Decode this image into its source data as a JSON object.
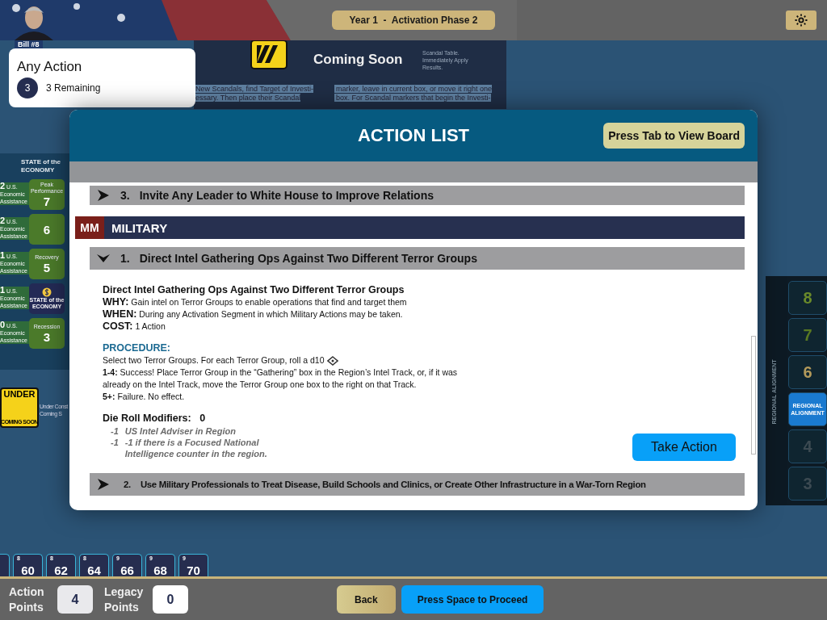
{
  "top_bar": {
    "phase": "Year 1  -  Activation Phase 2"
  },
  "bill_tag": "Bill #8",
  "action_card": {
    "title": "Any Action",
    "count": "3",
    "remaining": "3 Remaining"
  },
  "board_panel": {
    "coming_soon": "Coming Soon",
    "cells": [
      "Scandal Table.",
      "Immediately Apply",
      "Results."
    ],
    "left_text": [
      "New Scandals, find Target of Investi-",
      "essary. Then place their Scandal"
    ],
    "right_text": [
      "marker, leave in current box, or move it right one",
      "box. For Scandal markers that begin the Investi-"
    ]
  },
  "economy": {
    "heading": "STATE of the ECONOMY",
    "rows": [
      {
        "kind": "number",
        "aid": "2",
        "label": "U.S. Economic Assistance",
        "caption": "Peak Performance",
        "value": "7"
      },
      {
        "kind": "number",
        "aid": "2",
        "label": "U.S. Economic Assistance",
        "value": "6"
      },
      {
        "kind": "number",
        "aid": "1",
        "label": "U.S. Economic Assistance",
        "caption": "Recovery",
        "value": "5"
      },
      {
        "kind": "logo",
        "aid": "1",
        "label": "U.S. Economic Assistance",
        "value": "STATE of the ECONOMY"
      },
      {
        "kind": "number",
        "aid": "0",
        "label": "U.S. Economic Assistance",
        "caption": "Recession",
        "value": "3"
      }
    ]
  },
  "construction": {
    "sign_top": "UNDER",
    "sign_bottom": "COMING SOON",
    "lines": [
      "Under Const",
      "Coming S"
    ]
  },
  "alignment": {
    "label": "REGIONAL ALIGNMENT",
    "cells": [
      {
        "kind": "number",
        "value": "8",
        "color": "#6a8a2a"
      },
      {
        "kind": "number",
        "value": "7",
        "color": "#5a7a22"
      },
      {
        "kind": "number",
        "value": "6",
        "color": "#b39a5a"
      },
      {
        "kind": "marker",
        "value": "REGIONAL ALIGNMENT"
      },
      {
        "kind": "number",
        "value": "4",
        "color": "#3c4a52"
      },
      {
        "kind": "number",
        "value": "3",
        "color": "#3c4a52"
      }
    ]
  },
  "score_track": [
    {
      "tier": "8",
      "value": "60"
    },
    {
      "tier": "8",
      "value": "62"
    },
    {
      "tier": "8",
      "value": "64"
    },
    {
      "tier": "9",
      "value": "66"
    },
    {
      "tier": "9",
      "value": "68"
    },
    {
      "tier": "9",
      "value": "70"
    }
  ],
  "modal": {
    "title": "ACTION LIST",
    "view_board": "Press Tab to View Board",
    "prior_item": {
      "number": "3.",
      "title": "Invite Any Leader to White House to Improve Relations",
      "expanded": false
    },
    "section": {
      "code": "MM",
      "name": "MILITARY"
    },
    "items": [
      {
        "number": "1.",
        "title": "Direct Intel Gathering Ops Against Two Different Terror Groups",
        "expanded": true,
        "detail": {
          "heading": "Direct Intel Gathering Ops Against Two Different Terror Groups",
          "facts": [
            {
              "label": "WHY:",
              "text": "Gain intel on Terror Groups to enable operations that find and target them"
            },
            {
              "label": "WHEN:",
              "text": "During any Activation Segment in which Military Actions may be taken."
            },
            {
              "label": "COST:",
              "text": "1 Action"
            }
          ],
          "procedure_title": "PROCEDURE:",
          "procedure": [
            {
              "text": "Select two Terror Groups. For each Terror Group, roll a d10"
            },
            {
              "label": "1-4:",
              "text": "Success! Place Terror Group in the “Gathering” box in the Region’s Intel Track, or, if it was already on the Intel Track, move the Terror Group one box to the right on that Track."
            },
            {
              "label": "5+:",
              "text": "Failure. No effect."
            }
          ],
          "modifiers_title": "Die Roll Modifiers:",
          "modifiers_total": "0",
          "modifiers": [
            {
              "value": "-1",
              "text": "US Intel Adviser in Region",
              "active": false
            },
            {
              "value": "-1",
              "text": "-1 if there is a Focused National Intelligence counter in the region.",
              "active": false
            }
          ],
          "action_button": "Take Action"
        }
      },
      {
        "number": "2.",
        "title": "Use Military Professionals to Treat Disease, Build Schools and Clinics, or Create Other Infrastructure in a War-Torn Region",
        "expanded": false
      }
    ]
  },
  "bottom_bar": {
    "stats": [
      {
        "label": "Action Points",
        "value": "4",
        "highlight": false
      },
      {
        "label": "Legacy Points",
        "value": "0",
        "highlight": true
      }
    ],
    "back": "Back",
    "proceed": "Press Space to Proceed"
  }
}
